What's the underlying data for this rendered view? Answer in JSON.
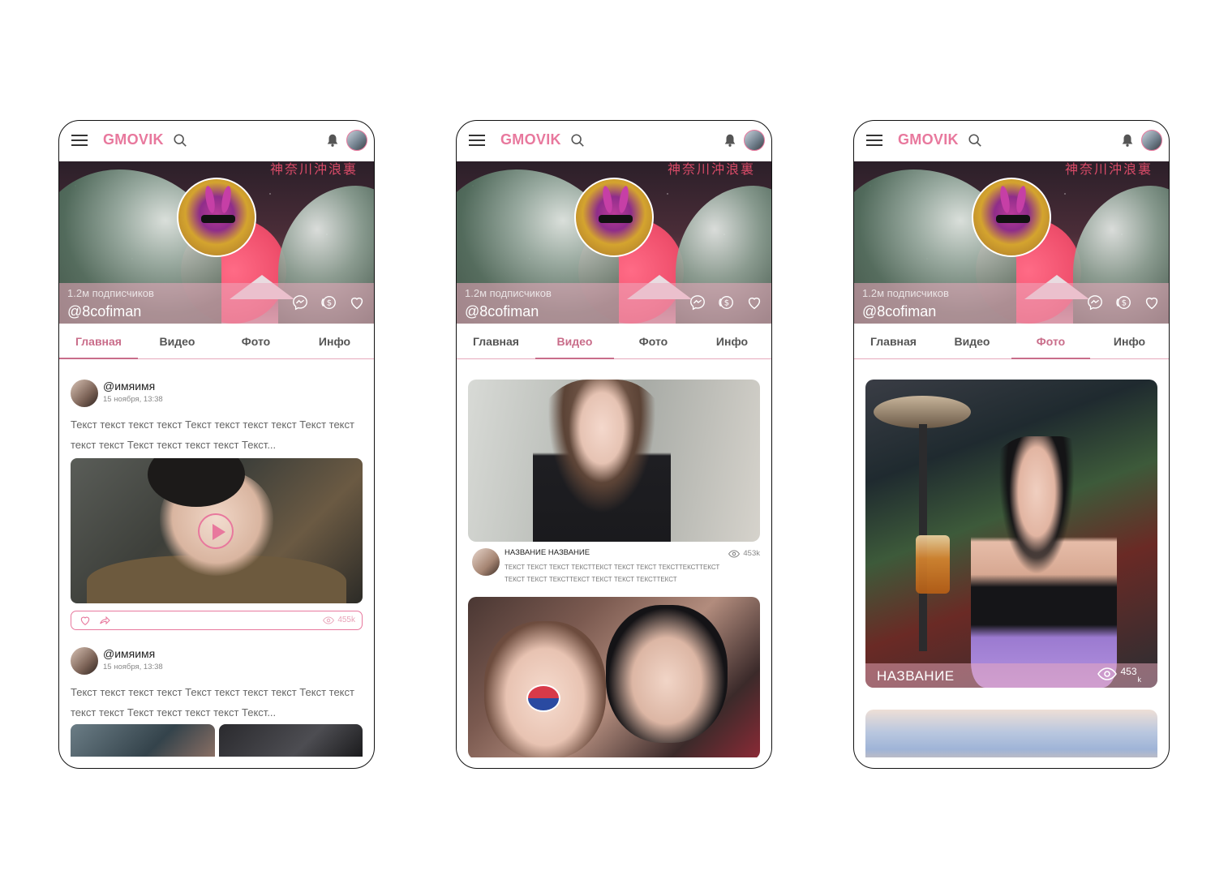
{
  "app": {
    "logo": "GMOVIK",
    "accent": "#e8789d",
    "banner_kanji": "神奈川沖浪裏",
    "subscribers": "1.2м подписчиков",
    "handle": "@8cofiman"
  },
  "tabs": [
    "Главная",
    "Видео",
    "Фото",
    "Инфо"
  ],
  "screens": [
    {
      "active_tab": "Главная"
    },
    {
      "active_tab": "Видео"
    },
    {
      "active_tab": "Фото"
    }
  ],
  "feed": {
    "posts": [
      {
        "user": "@имяимя",
        "date": "15 ноября, 13:38",
        "text": "Текст текст текст текст Текст текст текст текст Текст текст текст текст Текст текст текст текст Текст...",
        "views": "455k",
        "has_video": true
      },
      {
        "user": "@имяимя",
        "date": "15 ноября, 13:38",
        "text": "Текст текст текст текст Текст текст текст текст Текст текст текст текст Текст текст текст текст Текст..."
      }
    ]
  },
  "videos": [
    {
      "title": "НАЗВАНИЕ НАЗВАНИЕ",
      "description": "ТЕКСТ ТЕКСТ ТЕКСТ ТЕКСТТЕКСТ ТЕКСТ ТЕКСТ ТЕКСТТЕКСТТЕКСТ ТЕКСТ ТЕКСТ ТЕКСТТЕКСТ ТЕКСТ ТЕКСТ ТЕКСТТЕКСТ",
      "views": "453k"
    }
  ],
  "photos": [
    {
      "title": "НАЗВАНИЕ",
      "views": "453",
      "views_suffix": "k"
    }
  ],
  "icons": [
    "menu-icon",
    "search-icon",
    "bell-icon",
    "messenger-icon",
    "coins-icon",
    "heart-icon",
    "share-icon",
    "eye-icon",
    "play-icon"
  ]
}
